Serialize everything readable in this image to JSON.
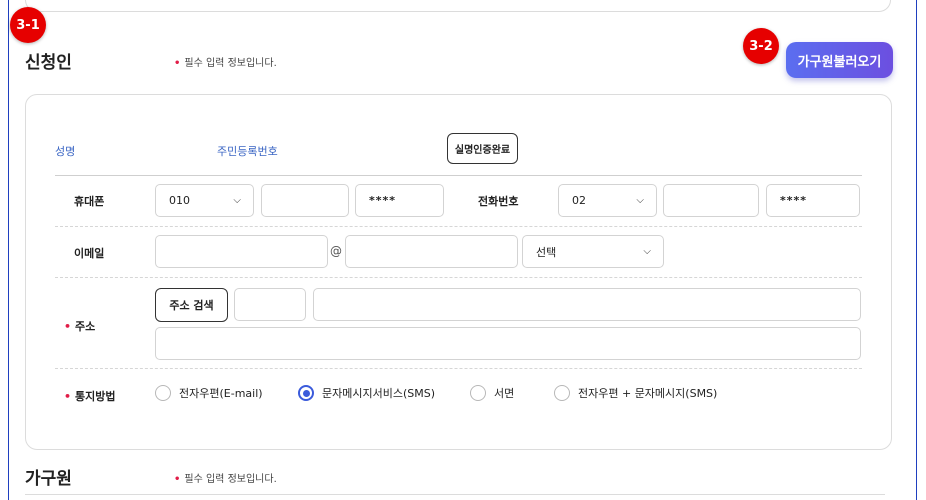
{
  "markers": {
    "m1": "3-1",
    "m2": "3-2"
  },
  "applicant": {
    "title": "신청인",
    "required_note": "필수 입력 정보입니다.",
    "load_family_button": "가구원불러오기",
    "name_label": "성명",
    "rrn_label": "주민등록번호",
    "verify_button": "실명인증완료"
  },
  "phone": {
    "mobile_label": "휴대폰",
    "mobile_prefix": "010",
    "mobile_middle": "",
    "mobile_last": "****",
    "tel_label": "전화번호",
    "tel_prefix": "02",
    "tel_middle": "",
    "tel_last": "****"
  },
  "email": {
    "label": "이메일",
    "local": "",
    "at": "@",
    "domain": "",
    "domain_select": "선택"
  },
  "address": {
    "label": "주소",
    "search_button": "주소 검색",
    "zipcode": "",
    "line1": "",
    "line2": ""
  },
  "notify": {
    "label": "통지방법",
    "options": [
      {
        "label": "전자우편(E-mail)",
        "checked": false
      },
      {
        "label": "문자메시지서비스(SMS)",
        "checked": true
      },
      {
        "label": "서면",
        "checked": false
      },
      {
        "label": "전자우편 + 문자메시지(SMS)",
        "checked": false
      }
    ]
  },
  "family": {
    "title": "가구원",
    "required_note": "필수 입력 정보입니다."
  },
  "colors": {
    "accent": "#5b6ef0",
    "required": "#e11d48",
    "marker": "#e60000",
    "label_blue": "#3b66c4"
  }
}
